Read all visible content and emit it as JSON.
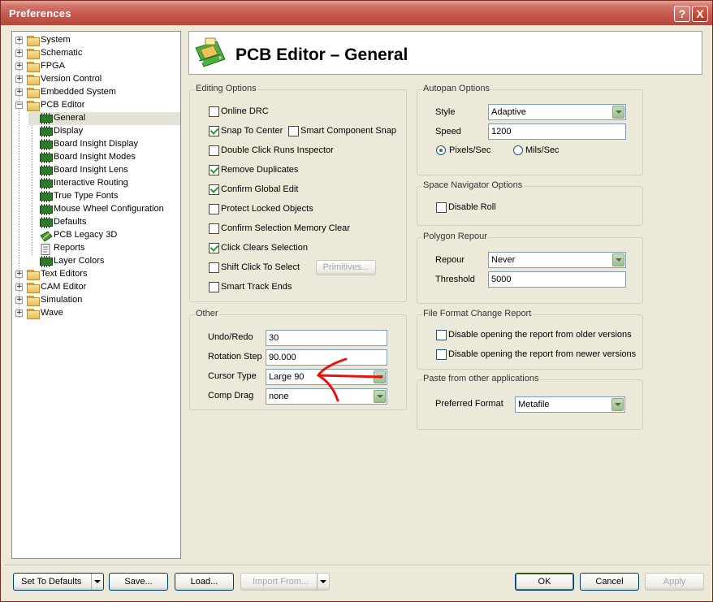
{
  "window": {
    "title": "Preferences",
    "help_glyph": "?",
    "close_glyph": "X"
  },
  "tree": [
    {
      "label": "System",
      "level": 0,
      "icon": "folder-icon",
      "expander": "+"
    },
    {
      "label": "Schematic",
      "level": 0,
      "icon": "folder-icon",
      "expander": "+"
    },
    {
      "label": "FPGA",
      "level": 0,
      "icon": "folder-icon",
      "expander": "+"
    },
    {
      "label": "Version Control",
      "level": 0,
      "icon": "folder-icon",
      "expander": "+"
    },
    {
      "label": "Embedded System",
      "level": 0,
      "icon": "folder-icon",
      "expander": "+"
    },
    {
      "label": "PCB Editor",
      "level": 0,
      "icon": "folder-open-icon",
      "expander": "−"
    },
    {
      "label": "General",
      "level": 1,
      "icon": "chip-icon",
      "selected": true
    },
    {
      "label": "Display",
      "level": 1,
      "icon": "chip-icon"
    },
    {
      "label": "Board Insight Display",
      "level": 1,
      "icon": "chip-icon"
    },
    {
      "label": "Board Insight Modes",
      "level": 1,
      "icon": "chip-icon"
    },
    {
      "label": "Board Insight Lens",
      "level": 1,
      "icon": "chip-icon"
    },
    {
      "label": "Interactive Routing",
      "level": 1,
      "icon": "chip-icon"
    },
    {
      "label": "True Type Fonts",
      "level": 1,
      "icon": "chip-icon"
    },
    {
      "label": "Mouse Wheel Configuration",
      "level": 1,
      "icon": "chip-icon"
    },
    {
      "label": "Defaults",
      "level": 1,
      "icon": "chip-icon"
    },
    {
      "label": "PCB Legacy 3D",
      "level": 1,
      "icon": "pcb-3d-icon"
    },
    {
      "label": "Reports",
      "level": 1,
      "icon": "report-icon"
    },
    {
      "label": "Layer Colors",
      "level": 1,
      "icon": "chip-icon"
    },
    {
      "label": "Text Editors",
      "level": 0,
      "icon": "folder-icon",
      "expander": "+"
    },
    {
      "label": "CAM Editor",
      "level": 0,
      "icon": "folder-icon",
      "expander": "+"
    },
    {
      "label": "Simulation",
      "level": 0,
      "icon": "folder-icon",
      "expander": "+"
    },
    {
      "label": "Wave",
      "level": 0,
      "icon": "folder-icon",
      "expander": "+"
    }
  ],
  "header": {
    "title": "PCB Editor – General"
  },
  "editing": {
    "title": "Editing Options",
    "items": [
      {
        "label": "Online DRC",
        "checked": false
      },
      {
        "label": "Snap To Center",
        "checked": true
      },
      {
        "label": "Double Click Runs Inspector",
        "checked": false
      },
      {
        "label": "Remove Duplicates",
        "checked": true
      },
      {
        "label": "Confirm Global Edit",
        "checked": true
      },
      {
        "label": "Protect Locked Objects",
        "checked": false
      },
      {
        "label": "Confirm Selection Memory Clear",
        "checked": false
      },
      {
        "label": "Click Clears Selection",
        "checked": true
      },
      {
        "label": "Shift Click To Select",
        "checked": false
      },
      {
        "label": "Smart Track Ends",
        "checked": false
      }
    ],
    "smart_snap": {
      "label": "Smart Component Snap",
      "checked": false
    },
    "primitives_label": "Primitives..."
  },
  "other": {
    "title": "Other",
    "undo_label": "Undo/Redo",
    "undo_value": "30",
    "rotation_label": "Rotation Step",
    "rotation_value": "90.000",
    "cursor_label": "Cursor Type",
    "cursor_value": "Large 90",
    "comp_label": "Comp Drag",
    "comp_value": "none"
  },
  "autopan": {
    "title": "Autopan Options",
    "style_label": "Style",
    "style_value": "Adaptive",
    "speed_label": "Speed",
    "speed_value": "1200",
    "pixels_label": "Pixels/Sec",
    "mils_label": "Mils/Sec",
    "pixels_selected": true
  },
  "navigator": {
    "title": "Space Navigator Options",
    "roll_label": "Disable Roll",
    "roll_checked": false
  },
  "polygon": {
    "title": "Polygon Repour",
    "repour_label": "Repour",
    "repour_value": "Never",
    "threshold_label": "Threshold",
    "threshold_value": "5000"
  },
  "fileformat": {
    "title": "File Format Change Report",
    "older_label": "Disable opening the report from older versions",
    "newer_label": "Disable opening the report from newer versions"
  },
  "paste": {
    "title": "Paste from other applications",
    "format_label": "Preferred Format",
    "format_value": "Metafile"
  },
  "footer": {
    "defaults_label": "Set To Defaults",
    "save_label": "Save...",
    "load_label": "Load...",
    "import_label": "Import From...",
    "ok_label": "OK",
    "cancel_label": "Cancel",
    "apply_label": "Apply"
  },
  "annotation": {
    "color": "#E8140C"
  }
}
